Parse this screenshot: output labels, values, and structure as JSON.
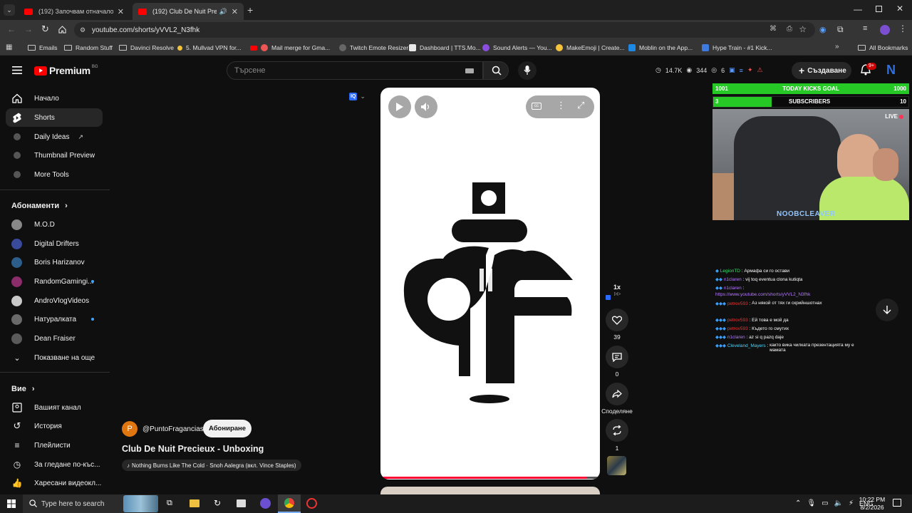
{
  "browser": {
    "tabs": [
      {
        "title": "(192) Започвам отначало - Y",
        "active": false
      },
      {
        "title": "(192) Club De Nuit Precieux",
        "active": true
      }
    ],
    "url": "youtube.com/shorts/yVVL2_N3fhk",
    "bookmarks": [
      "Emails",
      "Random Stuff",
      "Davinci Resolve",
      "5. Mullvad VPN for...",
      "Mail merge for Gma...",
      "Twitch Emote Resizer",
      "Dashboard | TTS.Mo...",
      "Sound Alerts — You...",
      "MakeEmoji | Create...",
      "Moblin on the App...",
      "Hype Train - #1 Kick..."
    ],
    "all_bookmarks": "All Bookmarks"
  },
  "youtube": {
    "logo": "Premium",
    "logo_region": "BG",
    "search_placeholder": "Търсене",
    "stats": {
      "followers": "14.7K",
      "viewers": "344",
      "watchers": "6"
    },
    "create_label": "Създаване",
    "notifications": "9+",
    "avatar_letter": "N"
  },
  "sidebar": {
    "main": [
      {
        "label": "Начало",
        "icon": "home-icon"
      },
      {
        "label": "Shorts",
        "icon": "shorts-icon"
      },
      {
        "label": "Daily Ideas",
        "icon": "vidiq-icon"
      },
      {
        "label": "Thumbnail Preview",
        "icon": "vidiq-icon"
      },
      {
        "label": "More Tools",
        "icon": "vidiq-icon"
      }
    ],
    "subs_title": "Абонаменти",
    "subs": [
      {
        "label": "M.O.D",
        "dot": false,
        "color": "#888888"
      },
      {
        "label": "Digital Drifters",
        "dot": false,
        "color": "#3a4a9a"
      },
      {
        "label": "Boris Harizanov",
        "dot": false,
        "color": "#2d5d8a"
      },
      {
        "label": "RandomGamingi...",
        "dot": true,
        "color": "#8a2d6a"
      },
      {
        "label": "AndroVlogVideos",
        "dot": false,
        "color": "#c9c9c9"
      },
      {
        "label": "Натуралката",
        "dot": true,
        "color": "#6a6a6a"
      },
      {
        "label": "Dean Fraiser",
        "dot": false,
        "color": "#5a5a5a"
      }
    ],
    "show_more": "Показване на още",
    "you_title": "Вие",
    "you": [
      {
        "label": "Вашият канал",
        "icon": "channel-icon"
      },
      {
        "label": "История",
        "icon": "history-icon"
      },
      {
        "label": "Плейлисти",
        "icon": "playlist-icon"
      },
      {
        "label": "За гледане по-къс...",
        "icon": "watch-later-icon"
      },
      {
        "label": "Харесани видеокл...",
        "icon": "like-icon"
      }
    ]
  },
  "short": {
    "channel": "@PuntoFragancias",
    "channel_initial": "P",
    "subscribe": "Абониране",
    "title": "Club De Nuit Precieux - Unboxing",
    "sound": "Nothing Burns Like The Cold · Snoh Aalegra (вкл. Vince Staples)",
    "speed": "1x",
    "likes": "39",
    "comments": "0",
    "share": "Споделяне",
    "remix": "1",
    "vidiq": "IQ"
  },
  "overlay": {
    "goal_left": "1001",
    "goal_text": "TODAY KICKS GOAL",
    "goal_right": "1000",
    "sub_left": "3",
    "sub_text": "SUBSCRIBERS",
    "sub_right": "10",
    "live": "LIVE",
    "streamer": "NOOBCLEAVER",
    "chat": [
      {
        "user": "LegionTD",
        "msg": "Армафа си го остави",
        "color": "#2ee86b"
      },
      {
        "user": "n1claren",
        "msg": "vij toq eventua clona kutiqta",
        "color": "#b57bff"
      },
      {
        "user": "n1claren",
        "msg": "https://www.youtube.com/shorts/yVVL2_N3fhk",
        "color": "#b57bff"
      },
      {
        "user": "petrov593",
        "msg": "Аз някой от тях ги скрийншотнах",
        "color": "#e33"
      },
      {
        "user": "petrov593",
        "msg": "Ей това е мой да",
        "color": "#e33"
      },
      {
        "user": "petrov593",
        "msg": "Където го смутих",
        "color": "#e33"
      },
      {
        "user": "n1claren",
        "msg": "az si q pazq daje",
        "color": "#b57bff"
      },
      {
        "user": "Cleveland_Mayers",
        "msg": "както вика чилката презентацията му е мамата",
        "color": "#4ad6ff"
      }
    ]
  },
  "taskbar": {
    "search": "Type here to search",
    "lang": "ENG",
    "time": "10:22 PM",
    "date": "8/2/2026"
  }
}
